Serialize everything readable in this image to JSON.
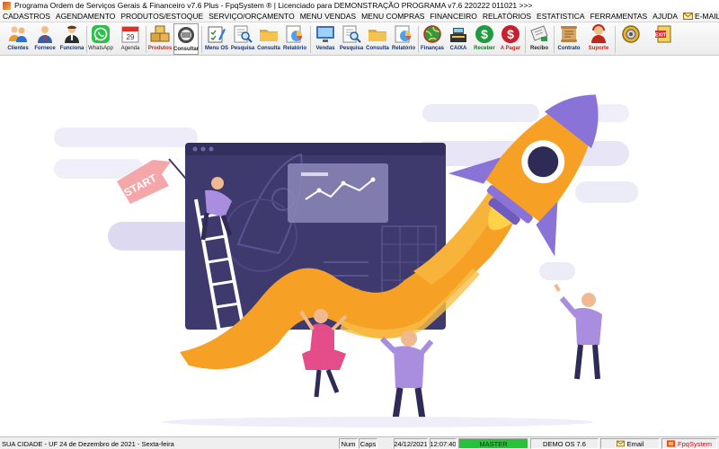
{
  "window": {
    "title": "Programa Ordem de Serviços Gerais & Financeiro v7.6 Plus - FpqSystem ® | Licenciado para  DEMONSTRAÇÃO PROGRAMA v7.6 220222 011021 >>>"
  },
  "menu": [
    "CADASTROS",
    "AGENDAMENTO",
    "PRODUTOS/ESTOQUE",
    "SERVIÇO/ORÇAMENTO",
    "MENU VENDAS",
    "MENU COMPRAS",
    "FINANCEIRO",
    "RELATÓRIOS",
    "ESTATISTICA",
    "FERRAMENTAS",
    "AJUDA",
    "E-MAIL"
  ],
  "toolbar": {
    "clientes": "Clientes",
    "fornece": "Fornece",
    "funciona": "Funciona",
    "whatsapp": "WhatsApp",
    "agenda": "Agenda",
    "calendar_day": "29",
    "produtos": "Produtos",
    "consultar": "Consultar",
    "menu_os": "Menu OS",
    "pesquisa1": "Pesquisa",
    "consulta1": "Consulta",
    "relatorio1": "Relatório",
    "vendas": "Vendas",
    "pesquisa2": "Pesquisa",
    "consulta2": "Consulta",
    "relatorio2": "Relatório",
    "financas": "Finanças",
    "caixa": "CAIXA",
    "receber": "Receber",
    "apagar": "A Pagar",
    "recibo": "Recibo",
    "contrato": "Contrato",
    "suporte": "Suporte",
    "exit": "EXIT"
  },
  "illustration": {
    "flag_text": "START"
  },
  "statusbar": {
    "city": "SUA CIDADE - UF 24 de Dezembro de 2021 - Sexta-feira",
    "num": "Num",
    "caps": "Caps",
    "date": "24/12/2021",
    "time": "12:07:40",
    "user": "MASTER",
    "version": "DEMO OS 7.6",
    "email": "Email",
    "brand": "FpqSystem"
  }
}
